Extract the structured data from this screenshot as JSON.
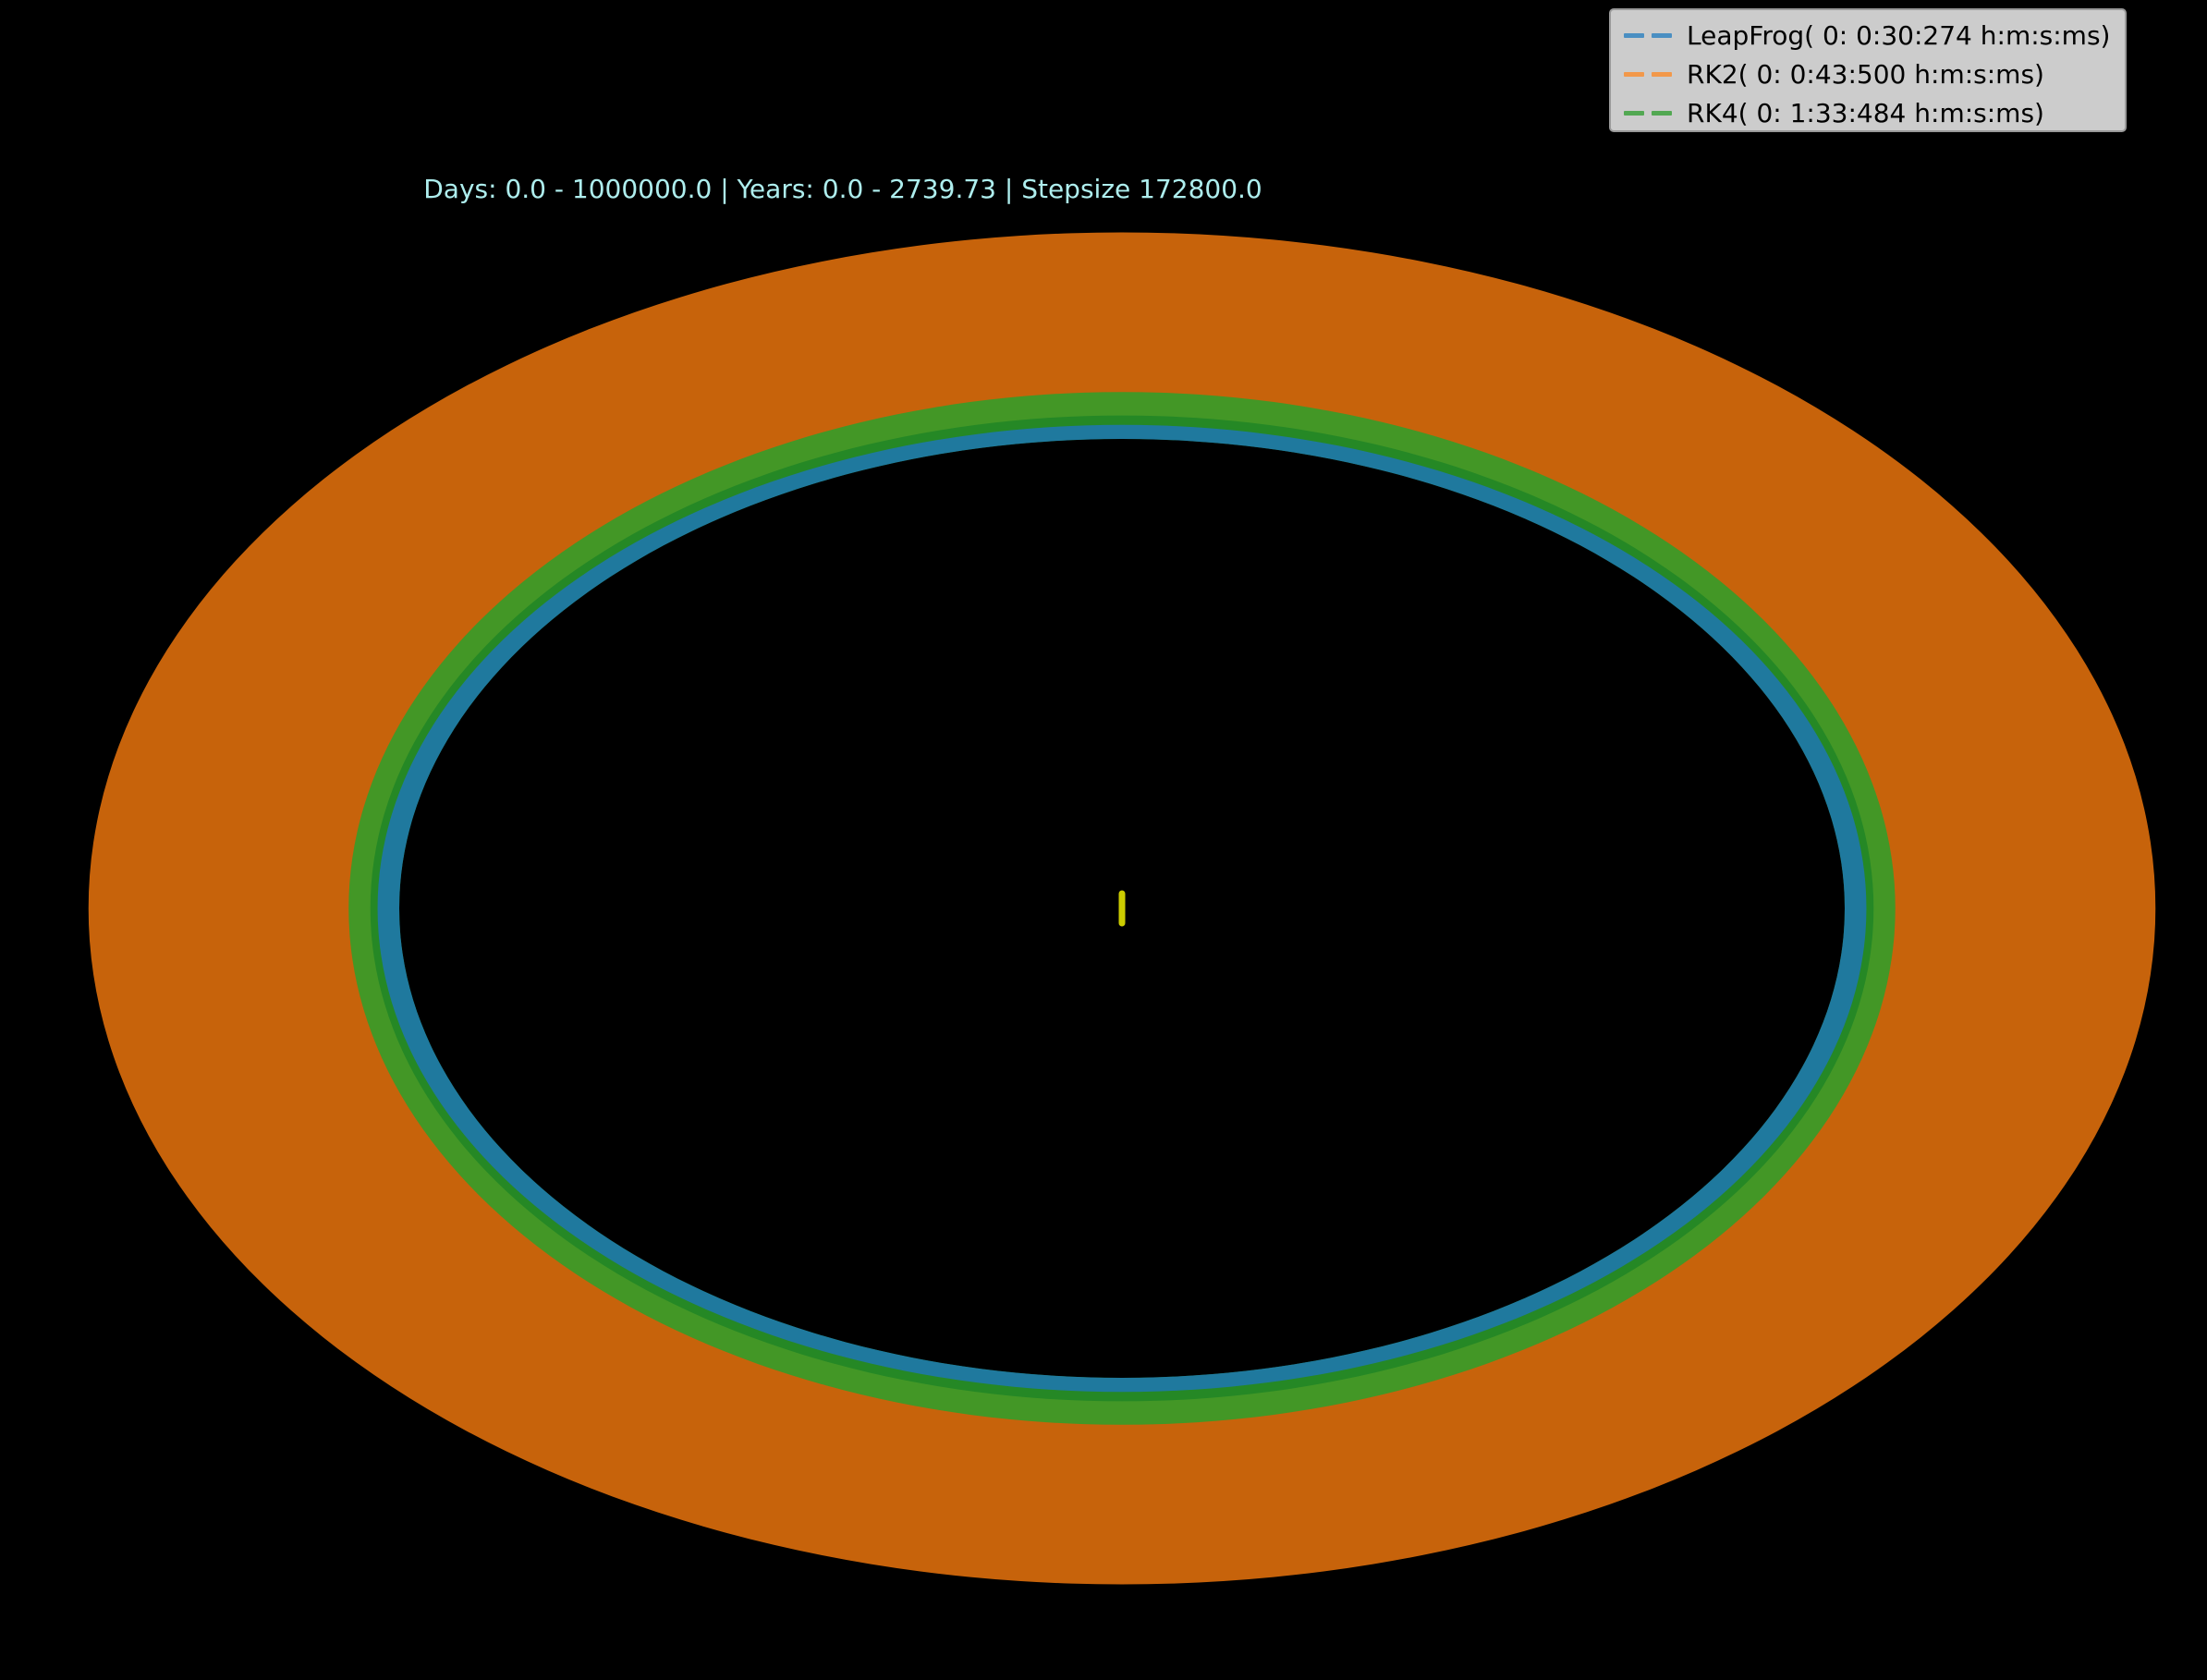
{
  "chart_data": {
    "type": "line",
    "title": "Days: 0.0 - 1000000.0 | Years: 0.0 - 2739.73 | Stepsize 172800.0",
    "xlabel": "",
    "ylabel": "",
    "axes_visible": false,
    "grid": false,
    "legend_placement": "top-right",
    "background_color": "#000000",
    "title_color": "#aeeeee",
    "series": [
      {
        "name": "LeapFrog( 0: 0:30:274 h:m:s:ms)",
        "color": "#1f77b4",
        "linestyle": "dashed",
        "ellipse": {
          "cx": 0.0,
          "cy": 0.0,
          "rx_inner": 1.0,
          "rx_outer": 1.03,
          "ry_inner": 1.0,
          "ry_outer": 1.03
        }
      },
      {
        "name": "RK2( 0: 0:43:500 h:m:s:ms)",
        "color": "#ff7f0e",
        "linestyle": "dashed",
        "ellipse": {
          "cx": 0.0,
          "cy": 0.0,
          "rx_inner": 1.04,
          "rx_outer": 1.43,
          "ry_inner": 1.05,
          "ry_outer": 1.44
        }
      },
      {
        "name": "RK4( 0: 1:33:484 h:m:s:ms)",
        "color": "#2ca02c",
        "linestyle": "dashed",
        "ellipse": {
          "cx": 0.0,
          "cy": 0.0,
          "rx_inner": 1.0,
          "rx_outer": 1.07,
          "ry_inner": 1.0,
          "ry_outer": 1.1
        }
      }
    ],
    "central_body": {
      "color": "#cccc00",
      "x": 0.0,
      "y": 0.0
    }
  }
}
